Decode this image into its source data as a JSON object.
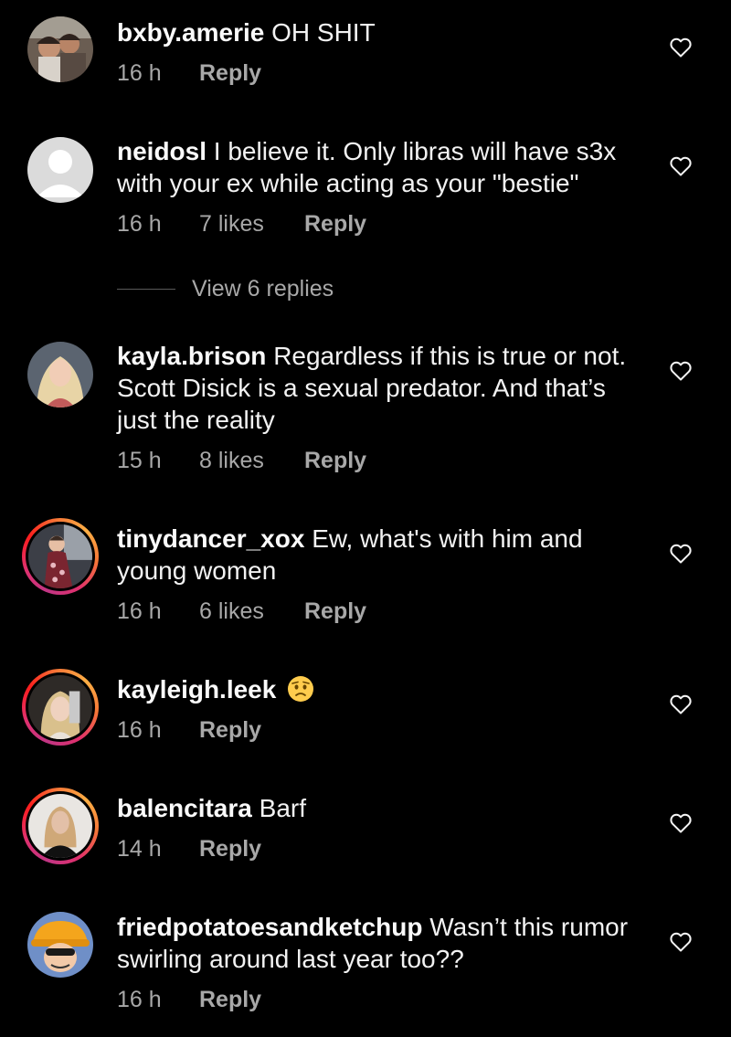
{
  "comments": [
    {
      "username": "bxby.amerie",
      "text": "OH SHIT",
      "time": "16 h",
      "likes": "",
      "reply_label": "Reply",
      "avatar": "photo-two-children",
      "story_ring": false
    },
    {
      "username": "neidosl",
      "text": "I believe it. Only libras will have s3x with your ex while acting as your \"bestie\"",
      "time": "16 h",
      "likes": "7 likes",
      "reply_label": "Reply",
      "avatar": "default-avatar",
      "story_ring": false
    },
    {
      "username": "kayla.brison",
      "text": "Regardless if this is true or not. Scott Disick is a sexual predator. And that’s just the reality",
      "time": "15 h",
      "likes": "8 likes",
      "reply_label": "Reply",
      "avatar": "photo-blonde-woman",
      "story_ring": false
    },
    {
      "username": "tinydancer_xox",
      "text": "Ew, what's with him and young women",
      "time": "16 h",
      "likes": "6 likes",
      "reply_label": "Reply",
      "avatar": "photo-woman-floral-dress",
      "story_ring": true
    },
    {
      "username": "kayleigh.leek",
      "text": "",
      "emoji": "worried-face",
      "time": "16 h",
      "likes": "",
      "reply_label": "Reply",
      "avatar": "photo-woman-selfie",
      "story_ring": true
    },
    {
      "username": "balencitara",
      "text": "Barf",
      "time": "14 h",
      "likes": "",
      "reply_label": "Reply",
      "avatar": "photo-woman-black-top",
      "story_ring": true
    },
    {
      "username": "friedpotatoesandketchup",
      "text": "Wasn’t this rumor swirling around last year too??",
      "time": "16 h",
      "likes": "",
      "reply_label": "Reply",
      "avatar": "cartoon-orange-hat",
      "story_ring": false
    }
  ],
  "view_replies_label": "View 6 replies",
  "colors": {
    "background": "#000000",
    "text": "#f2f2f2",
    "secondary_text": "#a8a8a8",
    "story_ring": [
      "#c13584",
      "#e1306c",
      "#fd1d1d",
      "#f77737",
      "#fcaf45"
    ]
  }
}
